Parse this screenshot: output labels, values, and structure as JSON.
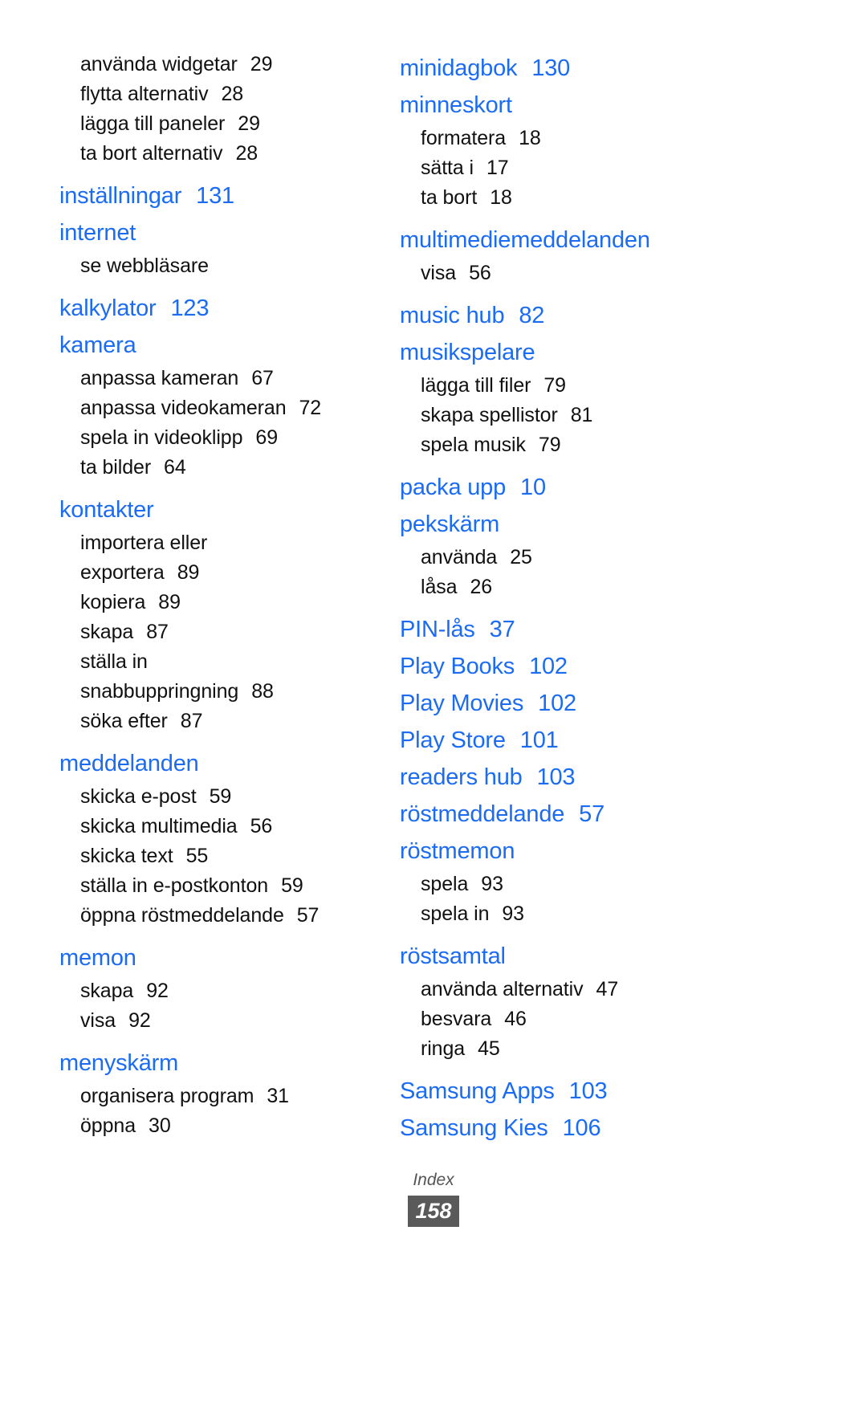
{
  "page": {
    "footer_label": "Index",
    "footer_page_number": "158",
    "accent_color": "#1b6cf2",
    "footer_badge_color": "#5a5a5a"
  },
  "columns": [
    {
      "name": "left-column",
      "items": [
        {
          "type": "subentry",
          "label": "använda widgetar",
          "page": "29"
        },
        {
          "type": "subentry",
          "label": "flytta alternativ",
          "page": "28"
        },
        {
          "type": "subentry",
          "label": "lägga till paneler",
          "page": "29"
        },
        {
          "type": "subentry",
          "label": "ta bort alternativ",
          "page": "28"
        },
        {
          "type": "entry",
          "label": "inställningar",
          "page": "131",
          "spaced": true
        },
        {
          "type": "entry",
          "label": "internet",
          "page": ""
        },
        {
          "type": "subentry",
          "label": "se webbläsare",
          "page": ""
        },
        {
          "type": "entry",
          "label": "kalkylator",
          "page": "123",
          "spaced": true
        },
        {
          "type": "entry",
          "label": "kamera",
          "page": ""
        },
        {
          "type": "subentry",
          "label": "anpassa kameran",
          "page": "67"
        },
        {
          "type": "subentry",
          "label": "anpassa videokameran",
          "page": "72"
        },
        {
          "type": "subentry",
          "label": "spela in videoklipp",
          "page": "69"
        },
        {
          "type": "subentry",
          "label": "ta bilder",
          "page": "64"
        },
        {
          "type": "entry",
          "label": "kontakter",
          "page": "",
          "spaced": true
        },
        {
          "type": "subentry",
          "label": "importera eller",
          "page": ""
        },
        {
          "type": "subentry",
          "label": "exportera",
          "page": "89"
        },
        {
          "type": "subentry",
          "label": "kopiera",
          "page": "89"
        },
        {
          "type": "subentry",
          "label": "skapa",
          "page": "87"
        },
        {
          "type": "subentry",
          "label": "ställa in",
          "page": ""
        },
        {
          "type": "subentry",
          "label": "snabbuppringning",
          "page": "88"
        },
        {
          "type": "subentry",
          "label": "söka efter",
          "page": "87"
        },
        {
          "type": "entry",
          "label": "meddelanden",
          "page": "",
          "spaced": true
        },
        {
          "type": "subentry",
          "label": "skicka e-post",
          "page": "59"
        },
        {
          "type": "subentry",
          "label": "skicka multimedia",
          "page": "56"
        },
        {
          "type": "subentry",
          "label": "skicka text",
          "page": "55"
        },
        {
          "type": "subentry",
          "label": "ställa in e-postkonton",
          "page": "59"
        },
        {
          "type": "subentry",
          "label": "öppna röstmeddelande",
          "page": "57"
        },
        {
          "type": "entry",
          "label": "memon",
          "page": "",
          "spaced": true
        },
        {
          "type": "subentry",
          "label": "skapa",
          "page": "92"
        },
        {
          "type": "subentry",
          "label": "visa",
          "page": "92"
        },
        {
          "type": "entry",
          "label": "menyskärm",
          "page": "",
          "spaced": true
        },
        {
          "type": "subentry",
          "label": "organisera program",
          "page": "31"
        },
        {
          "type": "subentry",
          "label": "öppna",
          "page": "30"
        }
      ]
    },
    {
      "name": "right-column",
      "items": [
        {
          "type": "entry",
          "label": "minidagbok",
          "page": "130"
        },
        {
          "type": "entry",
          "label": "minneskort",
          "page": ""
        },
        {
          "type": "subentry",
          "label": "formatera",
          "page": "18"
        },
        {
          "type": "subentry",
          "label": "sätta i",
          "page": "17"
        },
        {
          "type": "subentry",
          "label": "ta bort",
          "page": "18"
        },
        {
          "type": "entry",
          "label": "multimediemeddelanden",
          "page": "",
          "spaced": true
        },
        {
          "type": "subentry",
          "label": "visa",
          "page": "56"
        },
        {
          "type": "entry",
          "label": "music hub",
          "page": "82",
          "spaced": true
        },
        {
          "type": "entry",
          "label": "musikspelare",
          "page": ""
        },
        {
          "type": "subentry",
          "label": "lägga till filer",
          "page": "79"
        },
        {
          "type": "subentry",
          "label": "skapa spellistor",
          "page": "81"
        },
        {
          "type": "subentry",
          "label": "spela musik",
          "page": "79"
        },
        {
          "type": "entry",
          "label": "packa upp",
          "page": "10",
          "spaced": true
        },
        {
          "type": "entry",
          "label": "pekskärm",
          "page": ""
        },
        {
          "type": "subentry",
          "label": "använda",
          "page": "25"
        },
        {
          "type": "subentry",
          "label": "låsa",
          "page": "26"
        },
        {
          "type": "entry",
          "label": "PIN-lås",
          "page": "37",
          "spaced": true
        },
        {
          "type": "entry",
          "label": "Play Books",
          "page": "102"
        },
        {
          "type": "entry",
          "label": "Play Movies",
          "page": "102"
        },
        {
          "type": "entry",
          "label": "Play Store",
          "page": "101"
        },
        {
          "type": "entry",
          "label": "readers hub",
          "page": "103"
        },
        {
          "type": "entry",
          "label": "röstmeddelande",
          "page": "57"
        },
        {
          "type": "entry",
          "label": "röstmemon",
          "page": ""
        },
        {
          "type": "subentry",
          "label": "spela",
          "page": "93"
        },
        {
          "type": "subentry",
          "label": "spela in",
          "page": "93"
        },
        {
          "type": "entry",
          "label": "röstsamtal",
          "page": "",
          "spaced": true
        },
        {
          "type": "subentry",
          "label": "använda alternativ",
          "page": "47"
        },
        {
          "type": "subentry",
          "label": "besvara",
          "page": "46"
        },
        {
          "type": "subentry",
          "label": "ringa",
          "page": "45"
        },
        {
          "type": "entry",
          "label": "Samsung Apps",
          "page": "103",
          "spaced": true
        },
        {
          "type": "entry",
          "label": "Samsung Kies",
          "page": "106"
        }
      ]
    }
  ]
}
